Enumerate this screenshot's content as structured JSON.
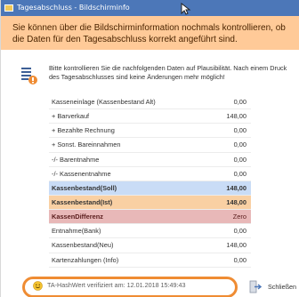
{
  "window": {
    "title": "Tagesabschluss - Bildschirminfo"
  },
  "banner": {
    "text": "Sie können über die Bildschirminformation nochmals kontrollieren, ob die Daten für den Tagesabschluss korrekt angeführt sind."
  },
  "intro": {
    "text": "Bitte kontrollieren Sie die nachfolgenden Daten auf Plausibilität. Nach einem Druck des Tagesabschlusses sind keine Änderungen mehr möglich!"
  },
  "rows": [
    {
      "label": "Kasseneinlage (Kassenbestand Alt)",
      "value": "0,00"
    },
    {
      "label": "+ Barverkauf",
      "value": "148,00"
    },
    {
      "label": "+ Bezahlte Rechnung",
      "value": "0,00"
    },
    {
      "label": "+ Sonst. Bareinnahmen",
      "value": "0,00"
    },
    {
      "label": "-/- Barentnahme",
      "value": "0,00"
    },
    {
      "label": "-/- Kassenentnahme",
      "value": "0,00"
    },
    {
      "label": "Kassenbestand(Soll)",
      "value": "148,00"
    },
    {
      "label": "Kassenbestand(Ist)",
      "value": "148,00"
    },
    {
      "label": "KassenDifferenz",
      "value": "Zero"
    },
    {
      "label": "Entnahme(Bank)",
      "value": "0,00"
    },
    {
      "label": "Kassenbestand(Neu)",
      "value": "148,00"
    },
    {
      "label": "Kartenzahlungen (Info)",
      "value": "0,00"
    }
  ],
  "footer": {
    "hash_text": "TA-HashWert verifiziert am: 12.01.2018 15:49:43",
    "close_label": "Schließen"
  },
  "colors": {
    "titlebar": "#4c77b8",
    "banner": "#ffca98",
    "soll_row": "#c9dcf6",
    "ist_row": "#f9d0a3",
    "diff_row": "#e8b8b8",
    "highlight_oval": "#ef8c33"
  },
  "icons": {
    "window": "app-window-icon",
    "intro": "document-list-icon",
    "hash": "smiley-icon",
    "close": "exit-door-icon"
  }
}
